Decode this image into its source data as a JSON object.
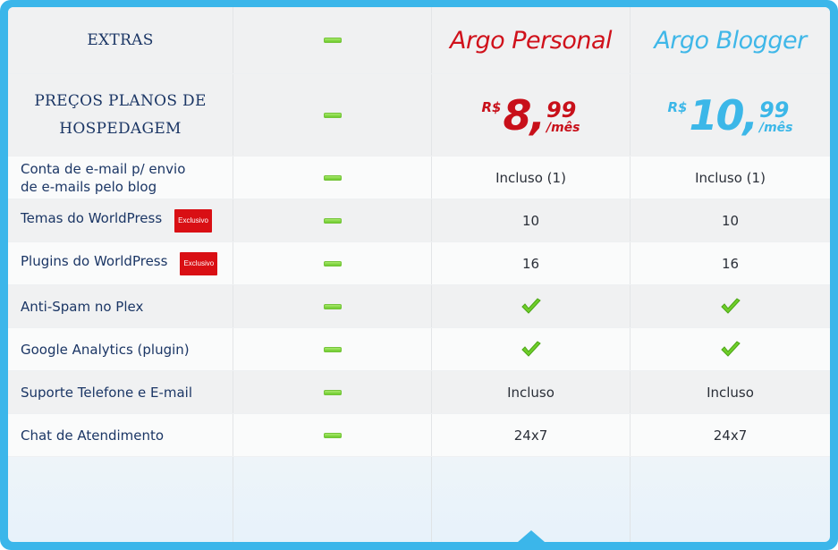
{
  "header": {
    "extras_label": "EXTRAS",
    "plan1_name": "Argo Personal",
    "plan2_name": "Argo Blogger"
  },
  "prices": {
    "label_line1": "PREÇOS PLANOS DE",
    "label_line2": "HOSPEDAGEM",
    "plan1": {
      "currency": "R$",
      "integer": "8,",
      "cents": "99",
      "period": "/mês"
    },
    "plan2": {
      "currency": "R$",
      "integer": "10,",
      "cents": "99",
      "period": "/mês"
    }
  },
  "features": [
    {
      "label_line1": "Conta de e-mail p/ envio",
      "label_line2": "de e-mails pelo blog",
      "badge": "",
      "plan1": "Incluso (1)",
      "plan2": "Incluso (1)"
    },
    {
      "label_line1": "Temas do WorldPress",
      "label_line2": "",
      "badge": "Exclusivo",
      "plan1": "10",
      "plan2": "10"
    },
    {
      "label_line1": "Plugins do WorldPress",
      "label_line2": "",
      "badge": "Exclusivo",
      "plan1": "16",
      "plan2": "16"
    },
    {
      "label_line1": "Anti-Spam no Plex",
      "label_line2": "",
      "badge": "",
      "plan1": "check-icon",
      "plan2": "check-icon"
    },
    {
      "label_line1": "Google Analytics (plugin)",
      "label_line2": "",
      "badge": "",
      "plan1": "check-icon",
      "plan2": "check-icon"
    },
    {
      "label_line1": "Suporte Telefone e E-mail",
      "label_line2": "",
      "badge": "",
      "plan1": "Incluso",
      "plan2": "Incluso"
    },
    {
      "label_line1": "Chat de Atendimento",
      "label_line2": "",
      "badge": "",
      "plan1": "24x7",
      "plan2": "24x7"
    }
  ],
  "colors": {
    "frame": "#3bb6ea",
    "plan1_accent": "#d0111b",
    "plan2_accent": "#3fb7e8",
    "label_text": "#1b3665",
    "badge_bg": "#d90f14",
    "dash_green": "#5ec21d"
  },
  "icons": {
    "empty_column_marker": "minus-dash-icon",
    "included_marker": "check-icon"
  }
}
